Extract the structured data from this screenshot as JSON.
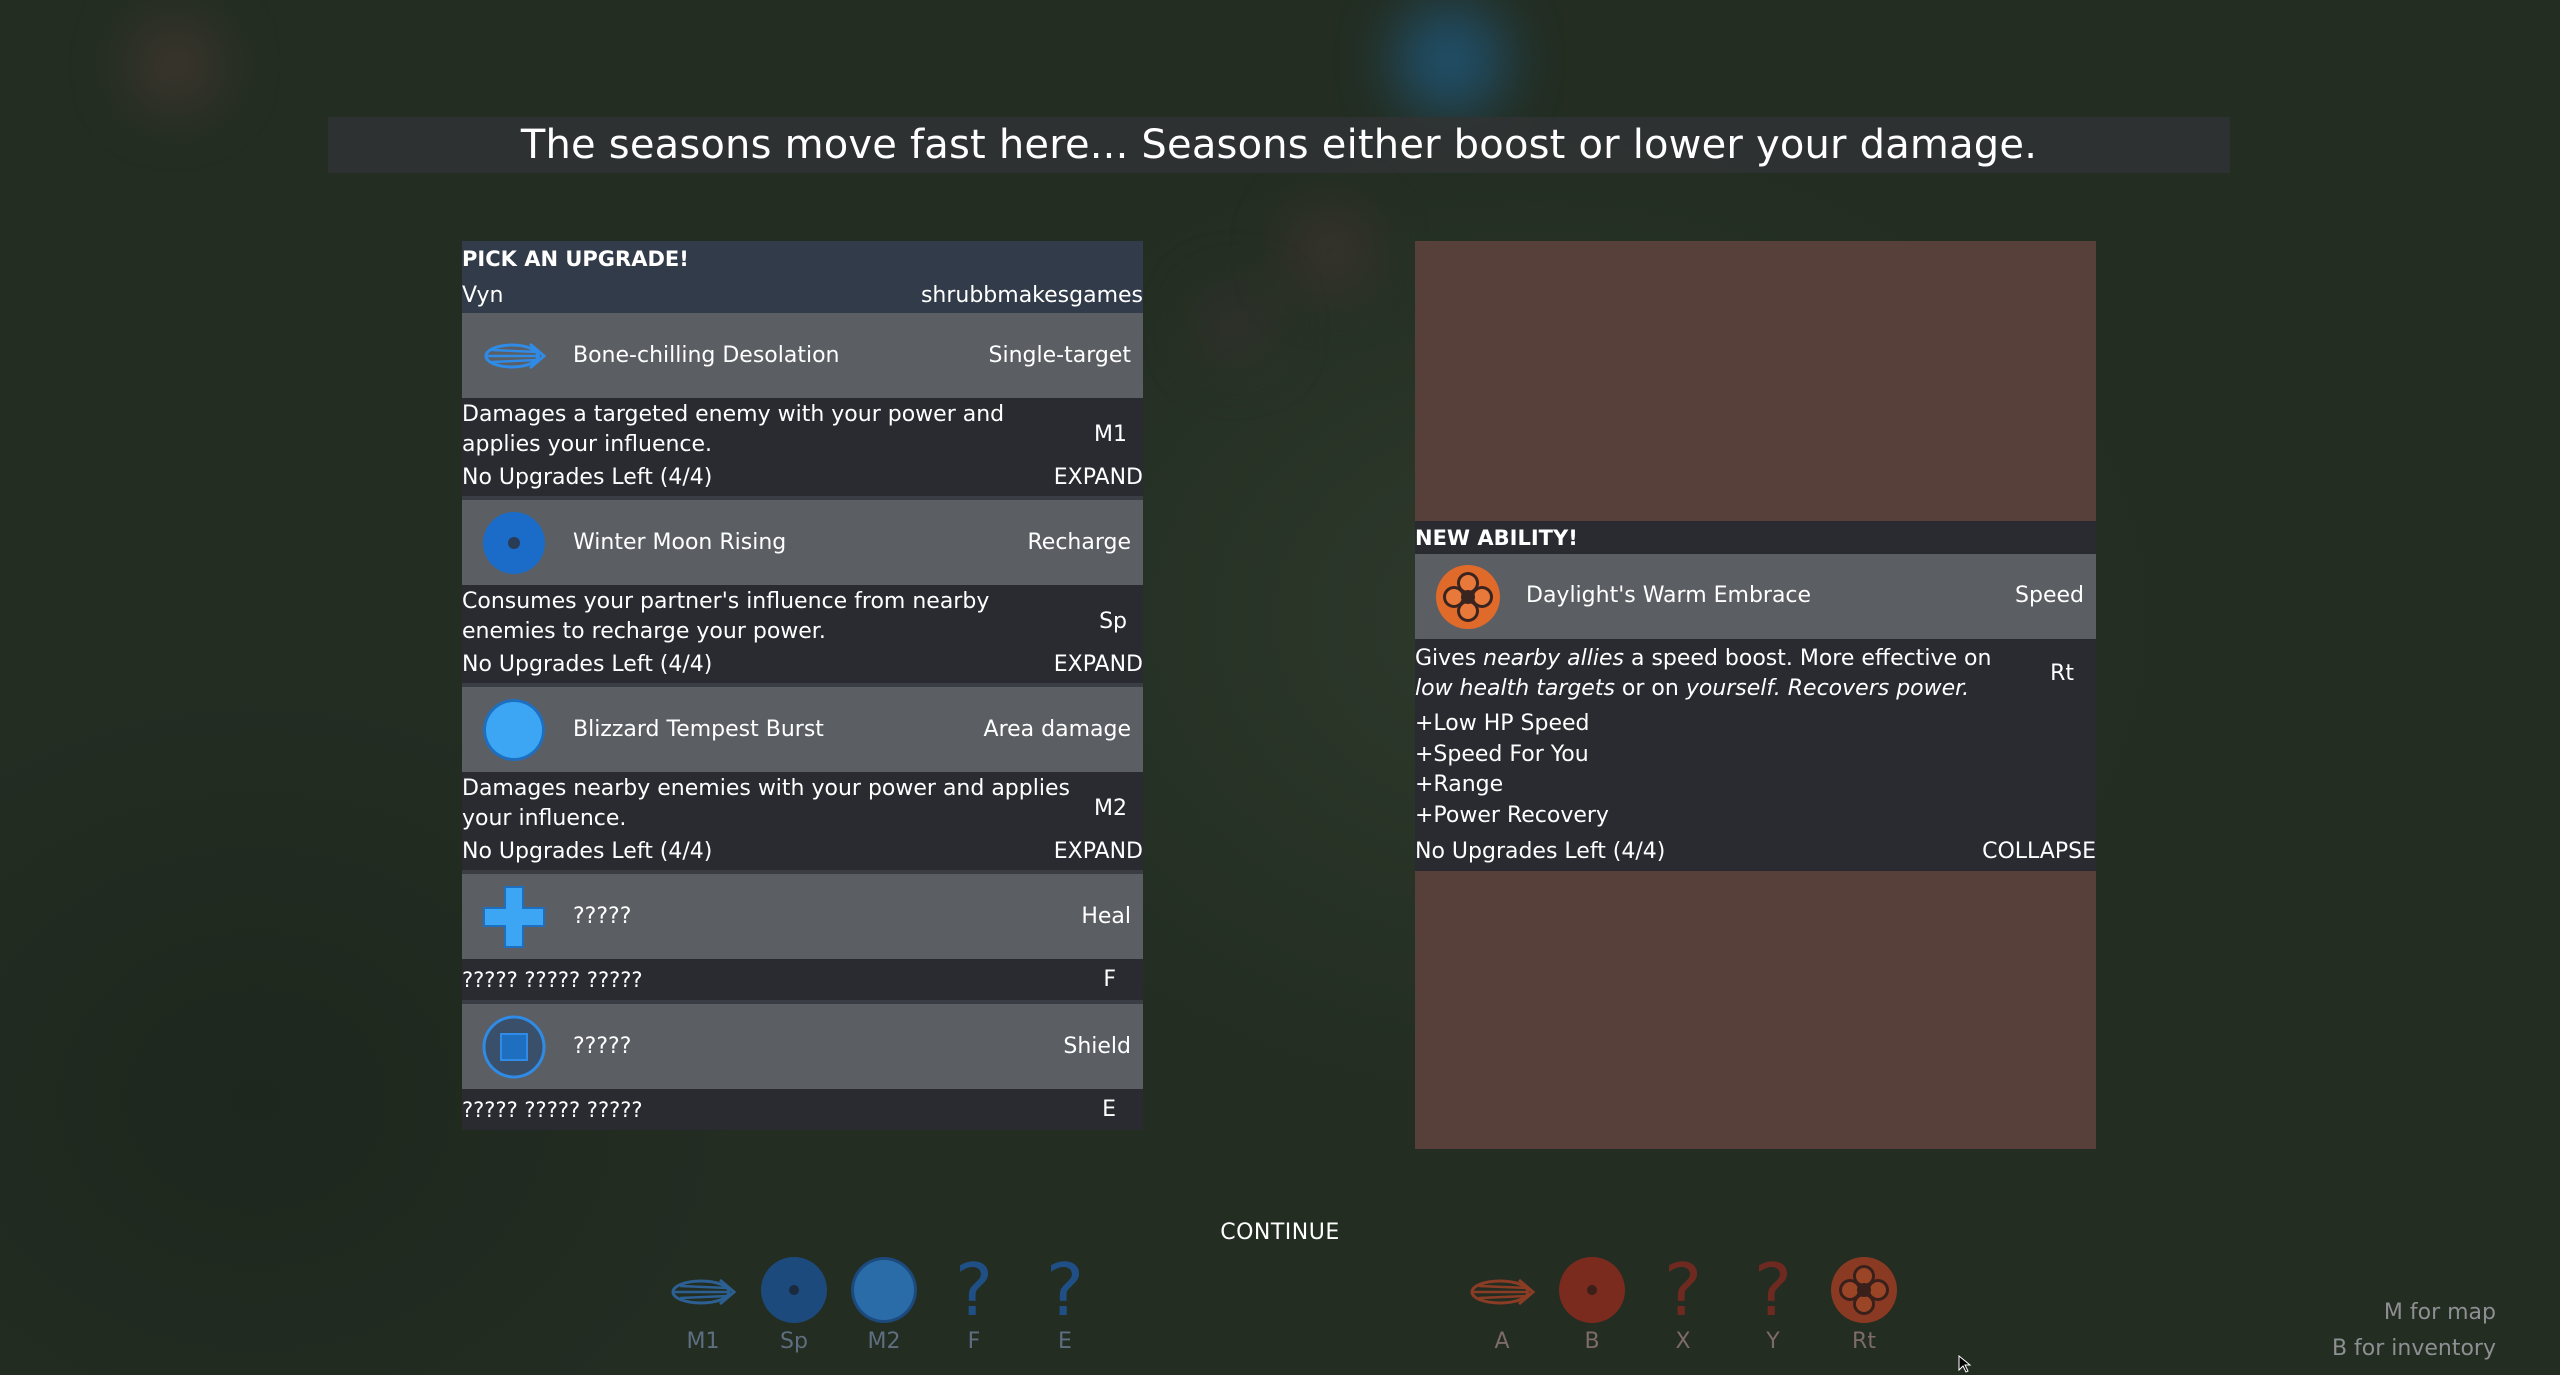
{
  "banner": {
    "text": "The seasons move fast here... Seasons either boost or lower your damage."
  },
  "upgrade_panel": {
    "header": "PICK AN UPGRADE!",
    "player": "Vyn",
    "author": "shrubbmakesgames",
    "abilities": [
      {
        "name": "Bone-chilling Desolation",
        "tag": "Single-target",
        "description": "Damages a targeted enemy with your power and applies your influence.",
        "key": "M1",
        "status": "No Upgrades Left (4/4)",
        "action": "EXPAND",
        "icon": "comet-streak-icon"
      },
      {
        "name": "Winter Moon Rising",
        "tag": "Recharge",
        "description": "Consumes your partner's influence from nearby enemies to recharge your power.",
        "key": "Sp",
        "status": "No Upgrades Left (4/4)",
        "action": "EXPAND",
        "icon": "moon-disc-icon"
      },
      {
        "name": "Blizzard Tempest Burst",
        "tag": "Area damage",
        "description": "Damages nearby enemies with your power and applies your influence.",
        "key": "M2",
        "status": "No Upgrades Left (4/4)",
        "action": "EXPAND",
        "icon": "circle-burst-icon"
      },
      {
        "name": "?????",
        "tag": "Heal",
        "description": "????? ????? ?????",
        "key": "F",
        "icon": "plus-heal-icon"
      },
      {
        "name": "?????",
        "tag": "Shield",
        "description": "????? ????? ?????",
        "key": "E",
        "icon": "square-shield-icon"
      }
    ]
  },
  "new_ability": {
    "header": "NEW ABILITY!",
    "name": "Daylight's Warm Embrace",
    "tag": "Speed",
    "description_parts": [
      "Gives ",
      "nearby allies",
      " a speed boost. More effective on ",
      "low health targets",
      " or on ",
      "yourself.",
      " ",
      "Recovers power."
    ],
    "key": "Rt",
    "perks": [
      "+Low HP Speed",
      "+Speed For You",
      "+Range",
      "+Power Recovery"
    ],
    "status": "No Upgrades Left (4/4)",
    "action": "COLLAPSE",
    "icon": "flower-icon"
  },
  "continue_label": "CONTINUE",
  "hotbar_left": [
    {
      "label": "M1",
      "icon": "comet-streak-icon"
    },
    {
      "label": "Sp",
      "icon": "moon-disc-icon"
    },
    {
      "label": "M2",
      "icon": "circle-burst-icon"
    },
    {
      "label": "F",
      "icon": "question-icon"
    },
    {
      "label": "E",
      "icon": "question-icon"
    }
  ],
  "hotbar_right": [
    {
      "label": "A",
      "icon": "comet-streak-icon"
    },
    {
      "label": "B",
      "icon": "moon-disc-icon"
    },
    {
      "label": "X",
      "icon": "question-icon"
    },
    {
      "label": "Y",
      "icon": "question-icon"
    },
    {
      "label": "Rt",
      "icon": "flower-icon"
    }
  ],
  "hints": [
    "M for map",
    "B for inventory"
  ],
  "colors": {
    "blue_accent": "#2f8be6",
    "orange_accent": "#e06a2a",
    "card_bg": "#5b5e63",
    "desc_bg": "#292b31",
    "right_panel_bg": "#573f3a"
  }
}
